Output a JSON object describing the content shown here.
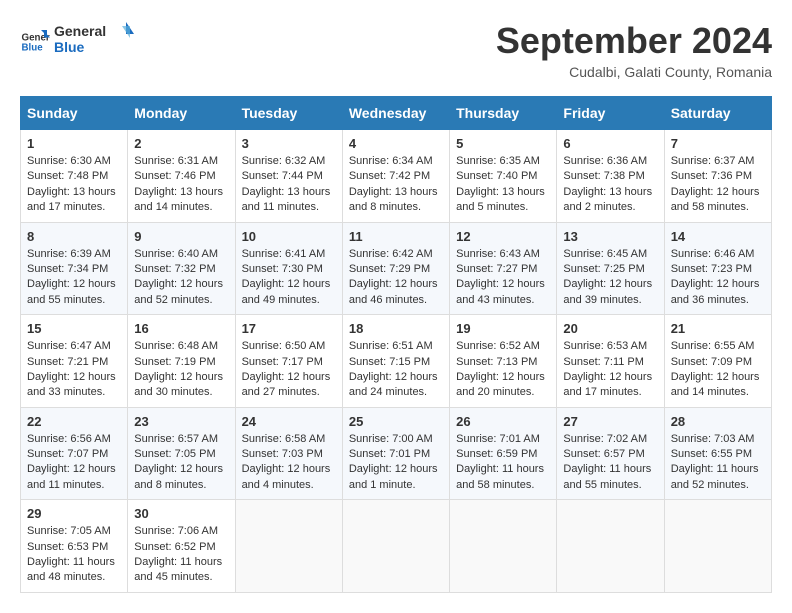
{
  "header": {
    "logo": {
      "general": "General",
      "blue": "Blue"
    },
    "title": "September 2024",
    "subtitle": "Cudalbi, Galati County, Romania"
  },
  "calendar": {
    "weekdays": [
      "Sunday",
      "Monday",
      "Tuesday",
      "Wednesday",
      "Thursday",
      "Friday",
      "Saturday"
    ],
    "weeks": [
      [
        {
          "day": "1",
          "sunrise": "6:30 AM",
          "sunset": "7:48 PM",
          "daylight": "13 hours and 17 minutes."
        },
        {
          "day": "2",
          "sunrise": "6:31 AM",
          "sunset": "7:46 PM",
          "daylight": "13 hours and 14 minutes."
        },
        {
          "day": "3",
          "sunrise": "6:32 AM",
          "sunset": "7:44 PM",
          "daylight": "13 hours and 11 minutes."
        },
        {
          "day": "4",
          "sunrise": "6:34 AM",
          "sunset": "7:42 PM",
          "daylight": "13 hours and 8 minutes."
        },
        {
          "day": "5",
          "sunrise": "6:35 AM",
          "sunset": "7:40 PM",
          "daylight": "13 hours and 5 minutes."
        },
        {
          "day": "6",
          "sunrise": "6:36 AM",
          "sunset": "7:38 PM",
          "daylight": "13 hours and 2 minutes."
        },
        {
          "day": "7",
          "sunrise": "6:37 AM",
          "sunset": "7:36 PM",
          "daylight": "12 hours and 58 minutes."
        }
      ],
      [
        {
          "day": "8",
          "sunrise": "6:39 AM",
          "sunset": "7:34 PM",
          "daylight": "12 hours and 55 minutes."
        },
        {
          "day": "9",
          "sunrise": "6:40 AM",
          "sunset": "7:32 PM",
          "daylight": "12 hours and 52 minutes."
        },
        {
          "day": "10",
          "sunrise": "6:41 AM",
          "sunset": "7:30 PM",
          "daylight": "12 hours and 49 minutes."
        },
        {
          "day": "11",
          "sunrise": "6:42 AM",
          "sunset": "7:29 PM",
          "daylight": "12 hours and 46 minutes."
        },
        {
          "day": "12",
          "sunrise": "6:43 AM",
          "sunset": "7:27 PM",
          "daylight": "12 hours and 43 minutes."
        },
        {
          "day": "13",
          "sunrise": "6:45 AM",
          "sunset": "7:25 PM",
          "daylight": "12 hours and 39 minutes."
        },
        {
          "day": "14",
          "sunrise": "6:46 AM",
          "sunset": "7:23 PM",
          "daylight": "12 hours and 36 minutes."
        }
      ],
      [
        {
          "day": "15",
          "sunrise": "6:47 AM",
          "sunset": "7:21 PM",
          "daylight": "12 hours and 33 minutes."
        },
        {
          "day": "16",
          "sunrise": "6:48 AM",
          "sunset": "7:19 PM",
          "daylight": "12 hours and 30 minutes."
        },
        {
          "day": "17",
          "sunrise": "6:50 AM",
          "sunset": "7:17 PM",
          "daylight": "12 hours and 27 minutes."
        },
        {
          "day": "18",
          "sunrise": "6:51 AM",
          "sunset": "7:15 PM",
          "daylight": "12 hours and 24 minutes."
        },
        {
          "day": "19",
          "sunrise": "6:52 AM",
          "sunset": "7:13 PM",
          "daylight": "12 hours and 20 minutes."
        },
        {
          "day": "20",
          "sunrise": "6:53 AM",
          "sunset": "7:11 PM",
          "daylight": "12 hours and 17 minutes."
        },
        {
          "day": "21",
          "sunrise": "6:55 AM",
          "sunset": "7:09 PM",
          "daylight": "12 hours and 14 minutes."
        }
      ],
      [
        {
          "day": "22",
          "sunrise": "6:56 AM",
          "sunset": "7:07 PM",
          "daylight": "12 hours and 11 minutes."
        },
        {
          "day": "23",
          "sunrise": "6:57 AM",
          "sunset": "7:05 PM",
          "daylight": "12 hours and 8 minutes."
        },
        {
          "day": "24",
          "sunrise": "6:58 AM",
          "sunset": "7:03 PM",
          "daylight": "12 hours and 4 minutes."
        },
        {
          "day": "25",
          "sunrise": "7:00 AM",
          "sunset": "7:01 PM",
          "daylight": "12 hours and 1 minute."
        },
        {
          "day": "26",
          "sunrise": "7:01 AM",
          "sunset": "6:59 PM",
          "daylight": "11 hours and 58 minutes."
        },
        {
          "day": "27",
          "sunrise": "7:02 AM",
          "sunset": "6:57 PM",
          "daylight": "11 hours and 55 minutes."
        },
        {
          "day": "28",
          "sunrise": "7:03 AM",
          "sunset": "6:55 PM",
          "daylight": "11 hours and 52 minutes."
        }
      ],
      [
        {
          "day": "29",
          "sunrise": "7:05 AM",
          "sunset": "6:53 PM",
          "daylight": "11 hours and 48 minutes."
        },
        {
          "day": "30",
          "sunrise": "7:06 AM",
          "sunset": "6:52 PM",
          "daylight": "11 hours and 45 minutes."
        },
        null,
        null,
        null,
        null,
        null
      ]
    ]
  }
}
